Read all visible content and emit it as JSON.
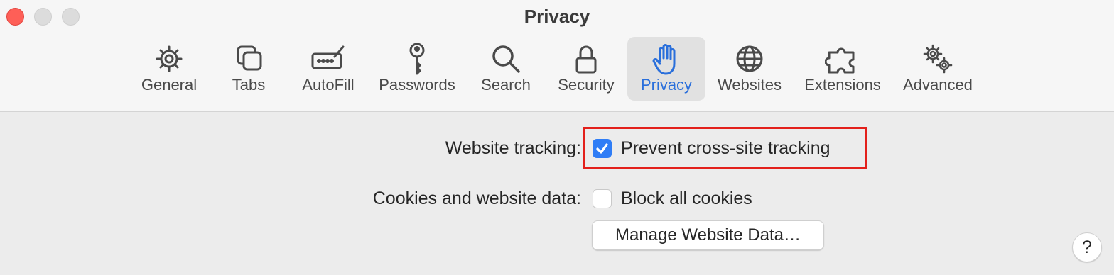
{
  "window": {
    "title": "Privacy"
  },
  "toolbar": {
    "tabs": [
      {
        "label": "General",
        "icon": "gear-icon"
      },
      {
        "label": "Tabs",
        "icon": "tabs-icon"
      },
      {
        "label": "AutoFill",
        "icon": "autofill-icon"
      },
      {
        "label": "Passwords",
        "icon": "key-icon"
      },
      {
        "label": "Search",
        "icon": "magnifier-icon"
      },
      {
        "label": "Security",
        "icon": "lock-icon"
      },
      {
        "label": "Privacy",
        "icon": "hand-icon",
        "selected": true
      },
      {
        "label": "Websites",
        "icon": "globe-icon"
      },
      {
        "label": "Extensions",
        "icon": "puzzle-icon"
      },
      {
        "label": "Advanced",
        "icon": "gears-icon"
      }
    ]
  },
  "settings": {
    "website_tracking": {
      "label": "Website tracking:",
      "option": "Prevent cross-site tracking",
      "checked": true
    },
    "cookies": {
      "label": "Cookies and website data:",
      "option": "Block all cookies",
      "checked": false
    },
    "manage_button": "Manage Website Data…"
  },
  "help": {
    "label": "?"
  },
  "colors": {
    "accent": "#2f7df6",
    "highlight": "#e3201b",
    "selected_tab_text": "#2a6fdb"
  }
}
